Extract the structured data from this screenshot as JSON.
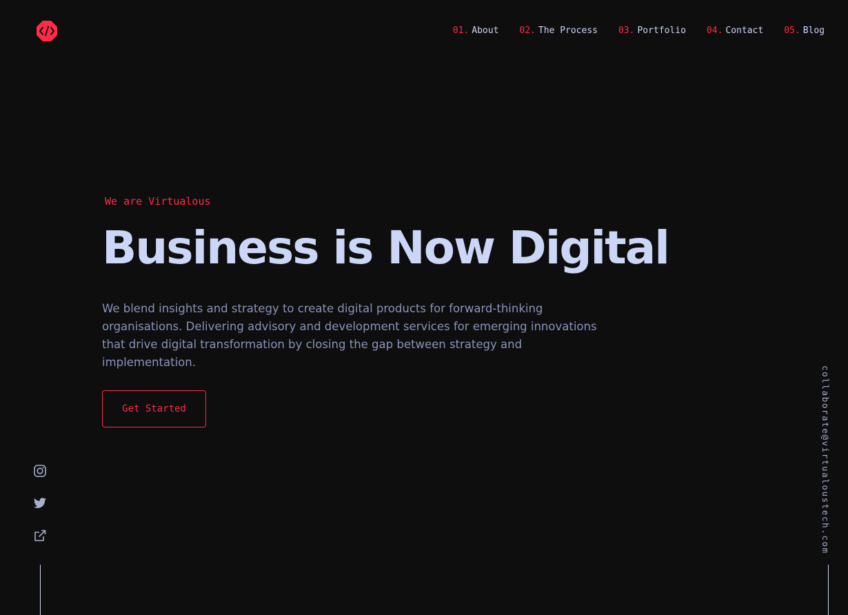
{
  "logo": {
    "icon": "code-brackets-logo",
    "color": "#ff2b47",
    "text": "</>"
  },
  "nav": {
    "items": [
      {
        "num": "01.",
        "label": "About"
      },
      {
        "num": "02.",
        "label": "The Process"
      },
      {
        "num": "03.",
        "label": "Portfolio"
      },
      {
        "num": "04.",
        "label": "Contact"
      },
      {
        "num": "05.",
        "label": "Blog"
      }
    ]
  },
  "hero": {
    "eyebrow": "We are Virtualous",
    "headline": "Business is Now Digital",
    "description": "We blend insights and strategy to create digital products for forward-thinking organisations. Delivering advisory and development services for emerging innovations that drive digital transformation by closing the gap between strategy and implementation.",
    "cta_label": "Get Started"
  },
  "social": {
    "icons": [
      "instagram-icon",
      "twitter-icon",
      "external-link-icon"
    ]
  },
  "contact": {
    "email": "collaborate@virtualoustech.com"
  },
  "colors": {
    "background": "#0e0e0f",
    "accent": "#ff2b47",
    "heading": "#ccd6f6",
    "body_text": "#8a94b8"
  }
}
